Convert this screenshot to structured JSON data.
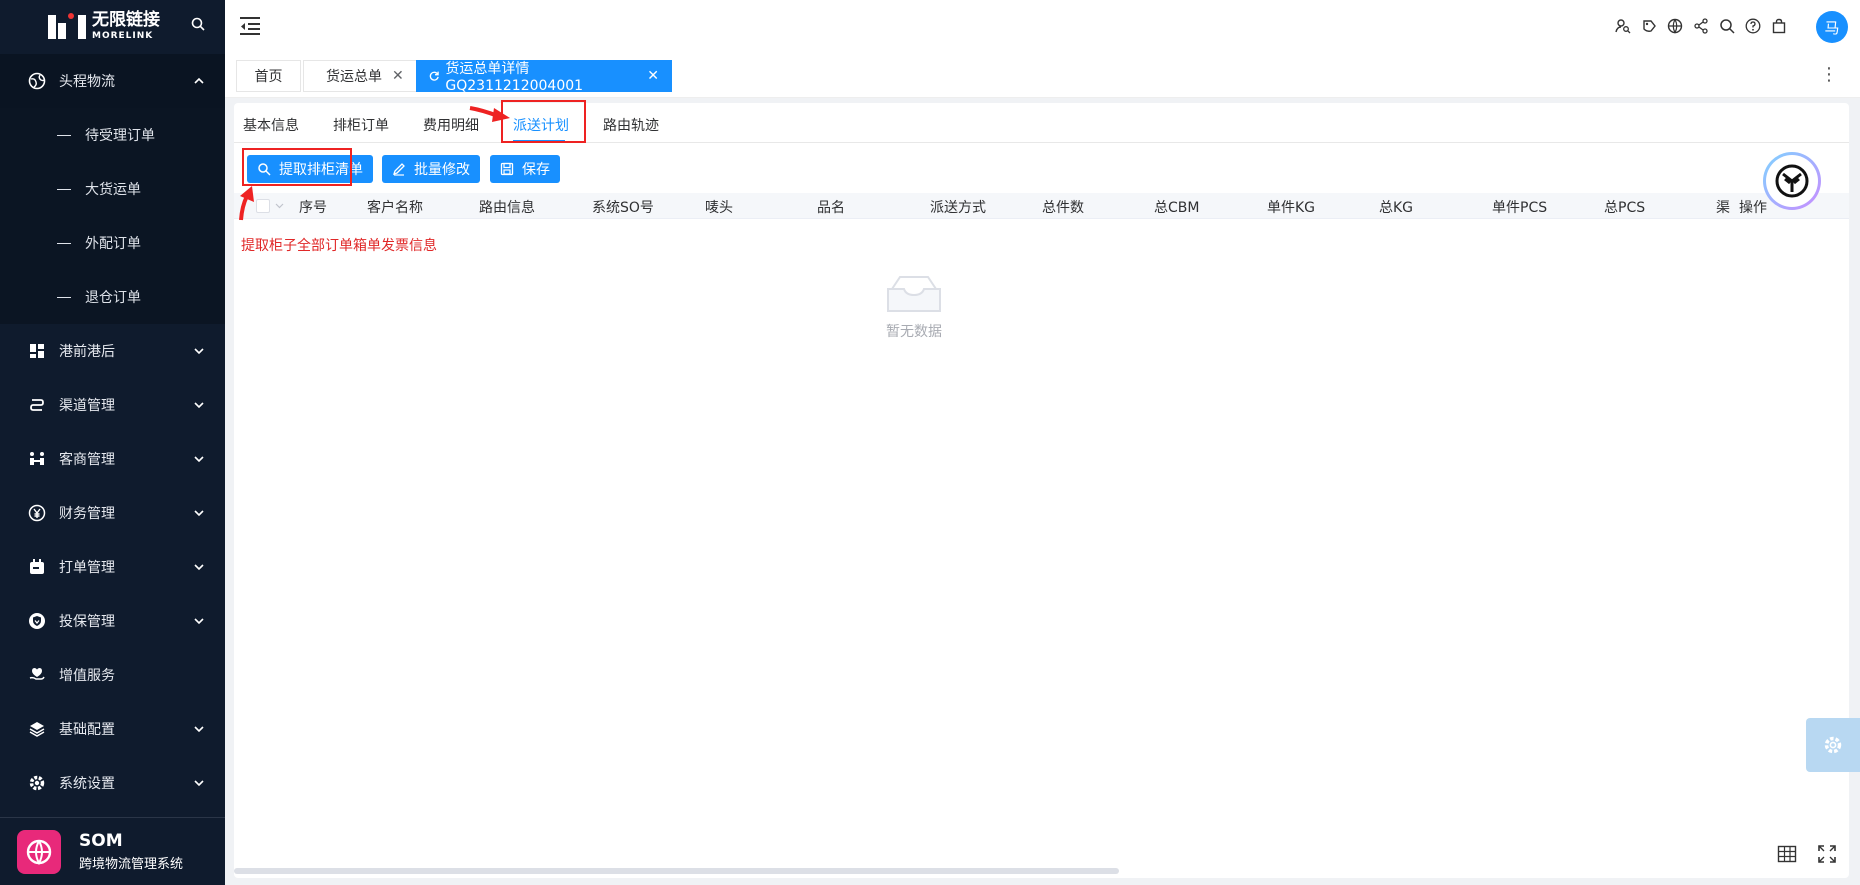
{
  "sidebar": {
    "logo": {
      "cn": "无限链接",
      "en": "MORELINK"
    },
    "menu": [
      {
        "label": "头程物流",
        "icon": "globe-icon",
        "open": true,
        "sub": [
          "待受理订单",
          "大货运单",
          "外配订单",
          "退仓订单"
        ]
      },
      {
        "label": "港前港后",
        "icon": "grid-icon"
      },
      {
        "label": "渠道管理",
        "icon": "route-icon"
      },
      {
        "label": "客商管理",
        "icon": "people-icon"
      },
      {
        "label": "财务管理",
        "icon": "yen-icon"
      },
      {
        "label": "打单管理",
        "icon": "print-icon"
      },
      {
        "label": "投保管理",
        "icon": "shield-icon"
      },
      {
        "label": "增值服务",
        "icon": "heart-hand-icon"
      },
      {
        "label": "基础配置",
        "icon": "layers-icon"
      },
      {
        "label": "系统设置",
        "icon": "gear-icon"
      }
    ],
    "footer": {
      "title": "SOM",
      "subtitle": "跨境物流管理系统"
    }
  },
  "topbar": {
    "avatar": "马",
    "icons": [
      "user-search-icon",
      "tag-icon",
      "globe-icon",
      "share-icon",
      "search-icon",
      "help-icon",
      "bag-icon"
    ]
  },
  "tabs": [
    {
      "label": "首页"
    },
    {
      "label": "货运总单"
    },
    {
      "label": "货运总单详情GQ2311212004001",
      "active": true
    }
  ],
  "subtabs": [
    "基本信息",
    "排柜订单",
    "费用明细",
    "派送计划",
    "路由轨迹"
  ],
  "active_subtab": "派送计划",
  "buttons": {
    "extract": "提取排柜清单",
    "batch_edit": "批量修改",
    "save": "保存"
  },
  "table": {
    "columns": [
      "序号",
      "客户名称",
      "路由信息",
      "系统SO号",
      "唛头",
      "品名",
      "派送方式",
      "总件数",
      "总CBM",
      "单件KG",
      "总KG",
      "单件PCS",
      "总PCS",
      "渠",
      "操作"
    ],
    "empty_text": "暂无数据"
  },
  "annotation": "提取柜子全部订单箱单发票信息",
  "colors": {
    "primary": "#1890ff",
    "sidebar": "#0f1b2d",
    "annotation": "#e02828"
  }
}
